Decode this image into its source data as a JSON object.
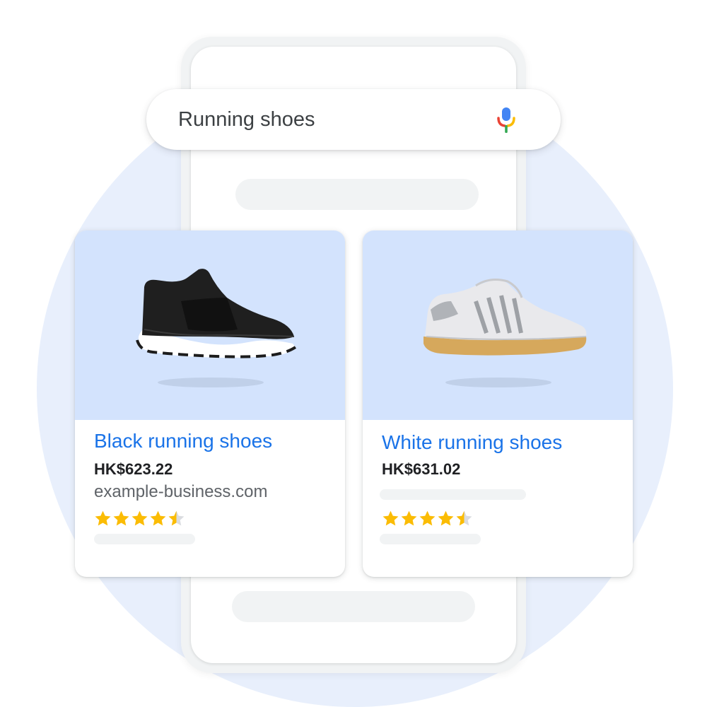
{
  "search": {
    "query": "Running shoes",
    "mic_icon": "microphone-icon",
    "mic_colors": [
      "#4285f4",
      "#ea4335",
      "#fbbc04",
      "#34a853"
    ]
  },
  "products": [
    {
      "title": "Black running shoes",
      "price": "HK$623.22",
      "domain": "example-business.com",
      "rating": 4.5,
      "rating_max": 5,
      "image": "black-slip-on-running-shoe"
    },
    {
      "title": "White running shoes",
      "price": "HK$631.02",
      "rating": 4.5,
      "rating_max": 5,
      "image": "white-running-shoe"
    }
  ],
  "colors": {
    "title_link": "#1a73e8",
    "star": "#fbbc04",
    "star_empty": "#dadce0",
    "card_image_bg": "#d3e3fd",
    "background_circle": "#e8effc"
  }
}
